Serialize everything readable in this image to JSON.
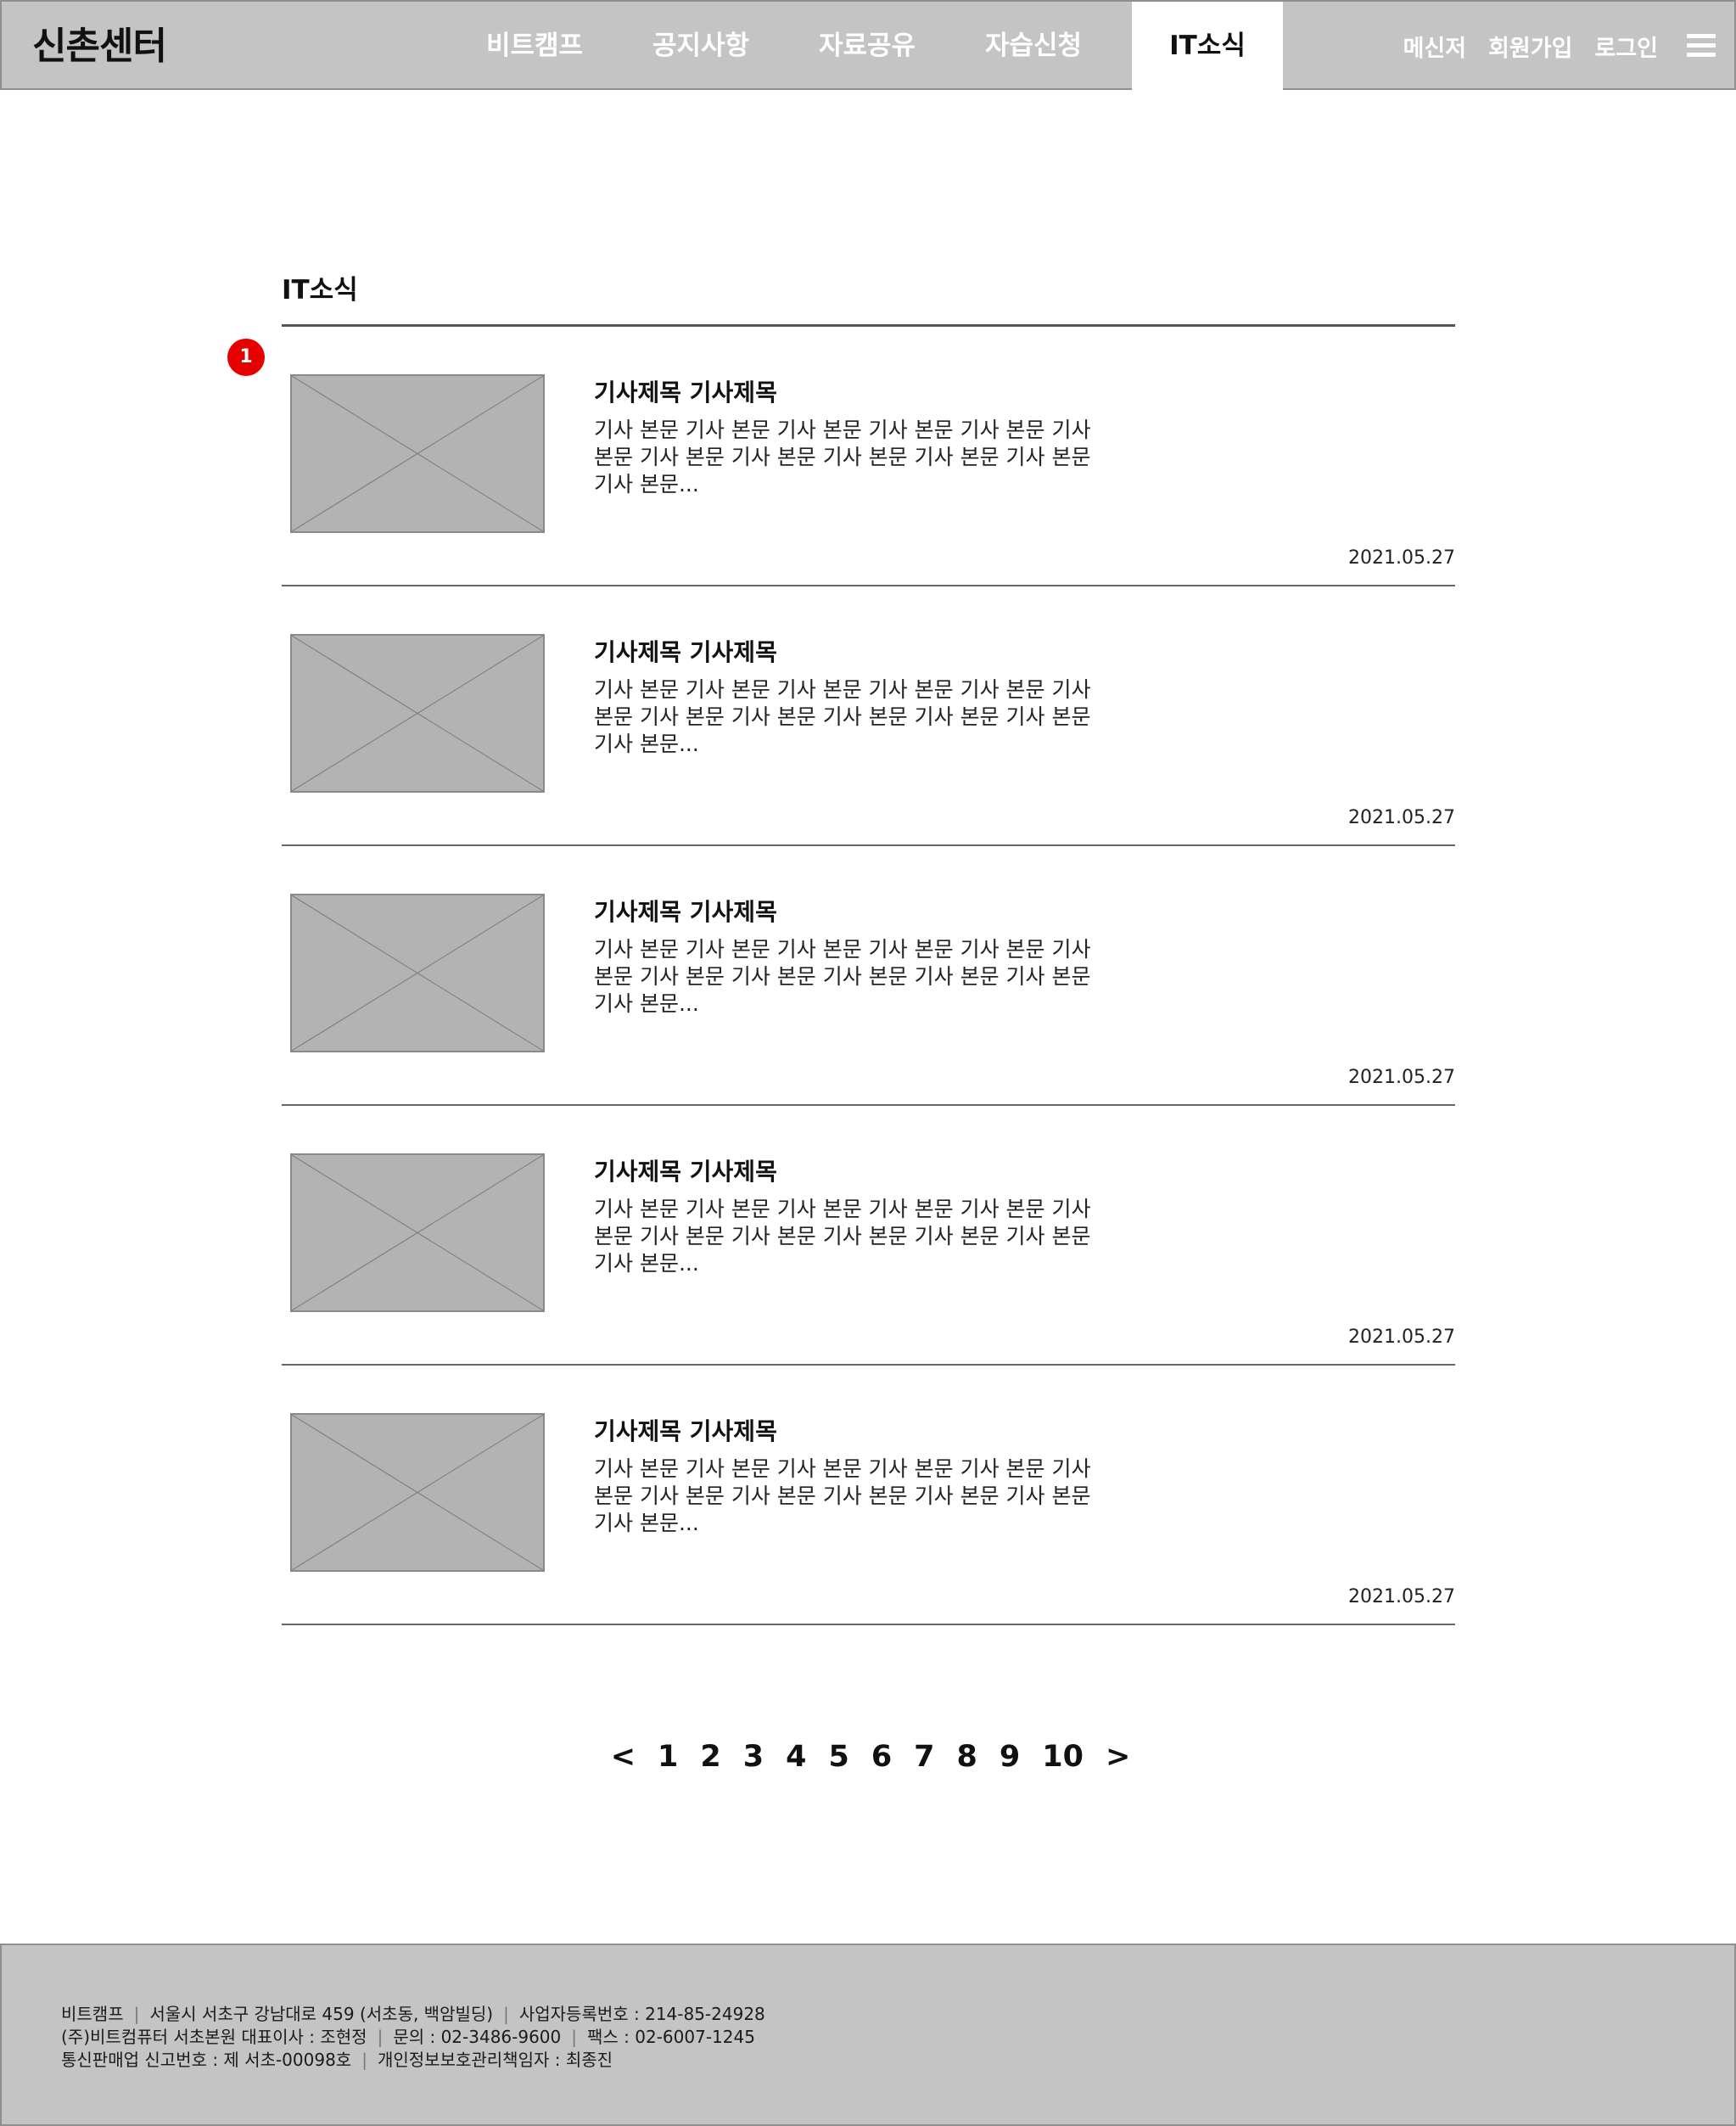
{
  "header": {
    "logo": "신촌센터",
    "nav": [
      "비트캠프",
      "공지사항",
      "자료공유",
      "자습신청",
      "IT소식"
    ],
    "active_nav": "IT소식",
    "util": [
      "메신저",
      "회원가입",
      "로그인"
    ]
  },
  "main": {
    "section_title": "IT소식",
    "badge": "1",
    "articles": [
      {
        "title": "기사제목 기사제목",
        "body": "기사 본문 기사 본문 기사 본문 기사 본문 기사 본문 기사 본문 기사 본문 기사 본문 기사 본문 기사 본문 기사 본문 기사 본문...",
        "date": "2021.05.27"
      },
      {
        "title": "기사제목 기사제목",
        "body": "기사 본문 기사 본문 기사 본문 기사 본문 기사 본문 기사 본문 기사 본문 기사 본문 기사 본문 기사 본문 기사 본문 기사 본문...",
        "date": "2021.05.27"
      },
      {
        "title": "기사제목 기사제목",
        "body": "기사 본문 기사 본문 기사 본문 기사 본문 기사 본문 기사 본문 기사 본문 기사 본문 기사 본문 기사 본문 기사 본문 기사 본문...",
        "date": "2021.05.27"
      },
      {
        "title": "기사제목 기사제목",
        "body": "기사 본문 기사 본문 기사 본문 기사 본문 기사 본문 기사 본문 기사 본문 기사 본문 기사 본문 기사 본문 기사 본문 기사 본문...",
        "date": "2021.05.27"
      },
      {
        "title": "기사제목 기사제목",
        "body": "기사 본문 기사 본문 기사 본문 기사 본문 기사 본문 기사 본문 기사 본문 기사 본문 기사 본문 기사 본문 기사 본문 기사 본문...",
        "date": "2021.05.27"
      }
    ]
  },
  "pagination": {
    "prev": "<",
    "pages": [
      "1",
      "2",
      "3",
      "4",
      "5",
      "6",
      "7",
      "8",
      "9",
      "10"
    ],
    "next": ">"
  },
  "footer": {
    "lines": [
      [
        "비트캠프",
        "서울시 서초구 강남대로 459 (서초동, 백암빌딩)",
        "사업자등록번호 : 214-85-24928"
      ],
      [
        "(주)비트컴퓨터 서초본원 대표이사 : 조현정",
        "문의 : 02-3486-9600",
        "팩스 : 02-6007-1245"
      ],
      [
        "통신판매업 신고번호 : 제 서초-00098호",
        "개인정보보호관리책임자 : 최종진"
      ]
    ]
  },
  "colors": {
    "header_bg": "#c4c4c4",
    "badge": "#e60000",
    "thumb": "#b3b3b3"
  }
}
